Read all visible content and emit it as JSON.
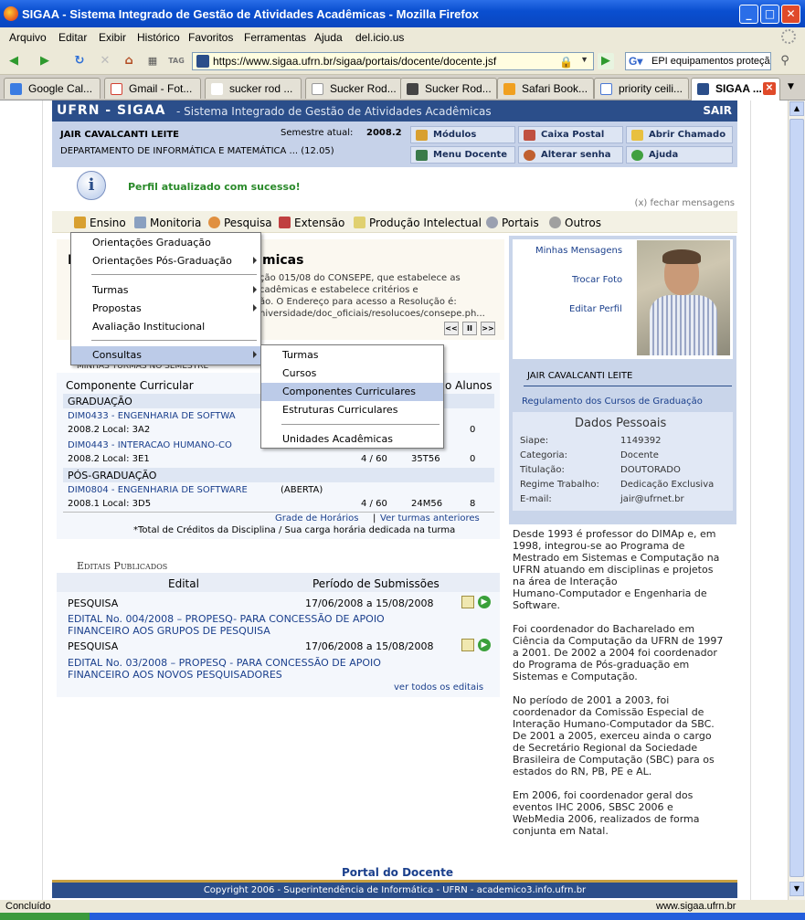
{
  "window": {
    "title": "SIGAA - Sistema Integrado de Gestão de Atividades Acadêmicas - Mozilla Firefox",
    "controls": [
      "_",
      "□",
      "✕"
    ]
  },
  "menubar": [
    "Arquivo",
    "Editar",
    "Exibir",
    "Histórico",
    "Favoritos",
    "Ferramentas",
    "Ajuda",
    "del.icio.us"
  ],
  "navbar": {
    "url": "https://www.sigaa.ufrn.br/sigaa/portais/docente/docente.jsf",
    "search": "EPI equipamentos proteçã"
  },
  "tabs": [
    {
      "label": "Google Cal...",
      "color": "#3b7ce2"
    },
    {
      "label": "Gmail - Fot...",
      "color": "#d23f31"
    },
    {
      "label": "sucker rod ...",
      "color": "#4a78d4"
    },
    {
      "label": "Sucker Rod...",
      "color": "#ffffff"
    },
    {
      "label": "Sucker Rod...",
      "color": "#444444"
    },
    {
      "label": "Safari Book...",
      "color": "#f0a020"
    },
    {
      "label": "priority ceili...",
      "color": "#4a78d4"
    },
    {
      "label": "SIGAA ...",
      "color": "#2b4e8a"
    }
  ],
  "sigaa": {
    "brand": "UFRN - SIGAA",
    "subtitle": "- Sistema Integrado de Gestão de Atividades Acadêmicas",
    "sair": "SAIR",
    "user_name": "JAIR CAVALCANTI LEITE",
    "semester_label": "Semestre atual:",
    "semester_value": "2008.2",
    "department": "DEPARTAMENTO DE INFORMÁTICA E MATEMÁTICA ... (12.05)",
    "buttons": {
      "modulos": "Módulos",
      "caixa_postal": "Caixa Postal",
      "abrir_chamado": "Abrir Chamado",
      "menu_docente": "Menu Docente",
      "alterar_senha": "Alterar senha",
      "ajuda": "Ajuda"
    },
    "success_message": "Perfil atualizado com sucesso!",
    "close_messages": "(x) fechar mensagens",
    "main_menu": [
      "Ensino",
      "Monitoria",
      "Pesquisa",
      "Extensão",
      "Produção Intelectual",
      "Portais",
      "Outros"
    ]
  },
  "ensino_menu": {
    "items": [
      "Orientações Graduação",
      "Orientações Pós-Graduação",
      "Turmas",
      "Propostas",
      "Avaliação Institucional",
      "Consultas"
    ]
  },
  "consultas_menu": {
    "items": [
      "Turmas",
      "Cursos",
      "Componentes Curriculares",
      "Estruturas Curriculares",
      "Unidades Acadêmicas"
    ]
  },
  "notice": {
    "title_fragment": "micas",
    "lines": [
      "ção 015/08 do CONSEPE, que estabelece as",
      "cadêmicas e estabelece critérios e",
      "ão. O Endereço para acesso a Resolução é:",
      "niversidade/doc_oficiais/resolucoes/consepe.ph..."
    ],
    "nav": [
      "<<",
      "II",
      ">>"
    ]
  },
  "turmas": {
    "section_title": "MINHAS TURMAS NO SEMESTRE",
    "col_componente": "Componente Curricular",
    "col_alunos": "o Alunos",
    "grad_label": "GRADUAÇÃO",
    "pos_label": "PÓS-GRADUAÇÃO",
    "rows": [
      {
        "code": "DIM0433 - ENGENHARIA DE SOFTWA",
        "status": "",
        "local": "2008.2 Local: 3A2",
        "vagas": "",
        "horario": "",
        "alunos": "0"
      },
      {
        "code": "DIM0443 - INTERACAO HUMANO-CO",
        "status": "",
        "local": "2008.2 Local: 3E1",
        "vagas": "4 / 60",
        "horario": "35T56",
        "alunos": "0"
      },
      {
        "code": "DIM0804 - ENGENHARIA DE SOFTWARE",
        "status": "(ABERTA)",
        "local": "2008.1 Local: 3D5",
        "vagas": "4 / 60",
        "horario": "24M56",
        "alunos": "8"
      }
    ],
    "grade_link": "Grade de Horários",
    "sep": "|",
    "anteriores_link": "Ver turmas anteriores",
    "footnote": "*Total de Créditos da Disciplina / Sua carga horária dedicada na turma"
  },
  "editais": {
    "section_title": "Editais Publicados",
    "col_edital": "Edital",
    "col_periodo": "Período de Submissões",
    "rows": [
      {
        "tipo": "PESQUISA",
        "periodo": "17/06/2008 a 15/08/2008",
        "titulo1": "EDITAL No. 004/2008 – PROPESQ- PARA CONCESSÃO DE APOIO",
        "titulo2": "FINANCEIRO AOS GRUPOS DE PESQUISA"
      },
      {
        "tipo": "PESQUISA",
        "periodo": "17/06/2008 a 15/08/2008",
        "titulo1": "EDITAL No. 03/2008 – PROPESQ - PARA CONCESSÃO DE APOIO",
        "titulo2": "FINANCEIRO AOS NOVOS PESQUISADORES"
      }
    ],
    "ver_todos": "ver todos os editais"
  },
  "profile": {
    "links": [
      "Minhas Mensagens",
      "Trocar Foto",
      "Editar Perfil"
    ],
    "name": "JAIR CAVALCANTI LEITE",
    "regulamento": "Regulamento dos Cursos de Graduação",
    "dados_title": "Dados Pessoais",
    "fields": [
      {
        "label": "Siape:",
        "value": "1149392"
      },
      {
        "label": "Categoria:",
        "value": "Docente"
      },
      {
        "label": "Titulação:",
        "value": "DOUTORADO"
      },
      {
        "label": "Regime Trabalho:",
        "value": "Dedicação Exclusiva"
      },
      {
        "label": "E-mail:",
        "value": "jair@ufrnet.br"
      }
    ],
    "bio": [
      "Desde 1993 é professor do DIMAp e, em",
      "1998, integrou-se ao Programa de",
      "Mestrado em Sistemas e Computação na",
      "UFRN atuando em disciplinas e projetos",
      "na área de Interação",
      "Humano-Computador e Engenharia de",
      "Software.",
      "",
      "Foi coordenador do Bacharelado em",
      "Ciência da Computação da UFRN de 1997",
      "a 2001. De 2002 a 2004 foi coordenador",
      "do Programa de Pós-graduação em",
      "Sistemas e Computação.",
      "",
      "No período de 2001 a 2003, foi",
      "coordenador da Comissão Especial de",
      "Interação Humano-Computador da SBC.",
      "De 2001 a 2005, exerceu ainda o cargo",
      "de Secretário Regional da Sociedade",
      "Brasileira de Computação (SBC) para os",
      "estados do RN, PB, PE e AL.",
      "",
      "Em 2006, foi coordenador geral dos",
      "eventos IHC 2006, SBSC 2006 e",
      "WebMedia 2006, realizados de forma",
      "conjunta em Natal."
    ]
  },
  "footer": {
    "portal": "Portal do Docente",
    "copyright": "Copyright 2006 - Superintendência de Informática - UFRN - academico3.info.ufrn.br"
  },
  "statusbar": {
    "left": "Concluído",
    "right": "www.sigaa.ufrn.br"
  }
}
